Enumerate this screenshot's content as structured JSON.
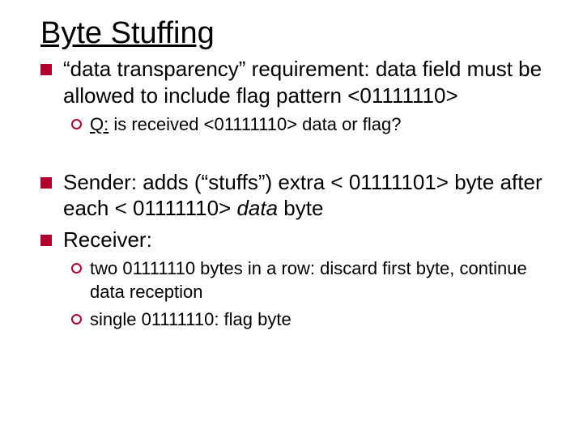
{
  "title": "Byte Stuffing",
  "b1": {
    "pre": "“data transparency” requirement: data field must be allowed to include flag pattern ",
    "pattern": "<01111110>"
  },
  "b1a": {
    "qlabel": "Q:",
    "rest": " is received <01111110> data or flag?"
  },
  "b2": {
    "pre": "Sender: adds (“stuffs”) extra < 01111101> byte after each < 01111110> ",
    "dataword": "data",
    "post": "  byte"
  },
  "b3": "Receiver:",
  "b3a": "two 01111110 bytes in a row: discard first byte, continue data reception",
  "b3b": "single 01111110: flag byte"
}
